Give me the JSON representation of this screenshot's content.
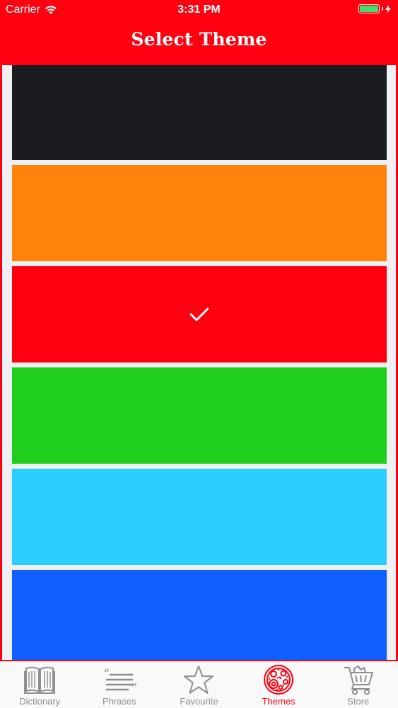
{
  "status_bar": {
    "carrier": "Carrier",
    "time": "3:31 PM",
    "battery_color": "#4cd964"
  },
  "header": {
    "title": "Select Theme",
    "background": "#ff0010"
  },
  "themes": [
    {
      "color": "#1b1c1f",
      "selected": false
    },
    {
      "color": "#ff820b",
      "selected": false
    },
    {
      "color": "#ff0010",
      "selected": true
    },
    {
      "color": "#20cf1b",
      "selected": false
    },
    {
      "color": "#29cdfe",
      "selected": false
    },
    {
      "color": "#0e5ffe",
      "selected": false
    }
  ],
  "tab_bar": {
    "active_color": "#ff0010",
    "inactive_color": "#8e8e93",
    "tabs": [
      {
        "label": "Dictionary",
        "icon": "book-icon",
        "active": false
      },
      {
        "label": "Phrases",
        "icon": "quote-lines-icon",
        "active": false
      },
      {
        "label": "Favourite",
        "icon": "star-icon",
        "active": false
      },
      {
        "label": "Themes",
        "icon": "palette-icon",
        "active": true
      },
      {
        "label": "Store",
        "icon": "cart-icon",
        "active": false
      }
    ]
  }
}
